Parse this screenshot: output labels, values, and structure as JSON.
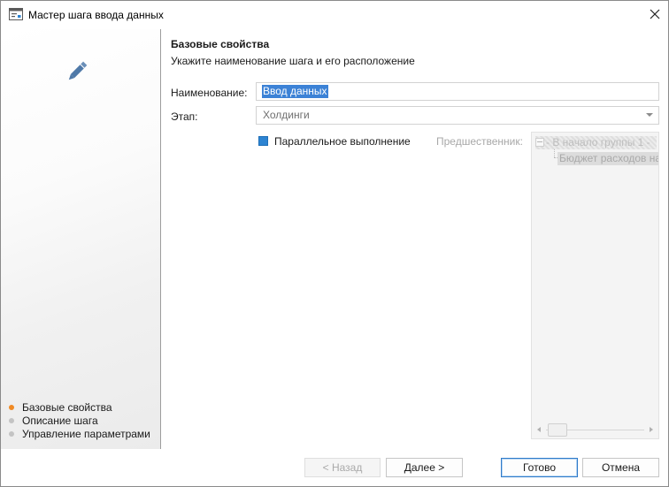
{
  "window": {
    "title": "Мастер шага ввода данных",
    "title_icon": "wizard-window-icon",
    "close_icon": "close-icon"
  },
  "sidebar": {
    "illustration_icon": "pencil-icon",
    "steps": [
      {
        "label": "Базовые свойства",
        "active": true
      },
      {
        "label": "Описание шага",
        "active": false
      },
      {
        "label": "Управление параметрами",
        "active": false
      }
    ],
    "active_color": "#f08a24",
    "inactive_color": "#c3c3c3"
  },
  "page": {
    "title": "Базовые свойства",
    "subtitle": "Укажите наименование шага и его расположение"
  },
  "form": {
    "name_label": "Наименование:",
    "name_value": "Ввод данных",
    "stage_label": "Этап:",
    "stage_value": "Холдинги",
    "parallel_label": "Параллельное выполнение",
    "parallel_checked": true,
    "predecessor_label": "Предшественник:",
    "predecessor_tree": [
      {
        "label": "- В начало группы 1 -"
      },
      {
        "label": "Бюджет расходов на"
      }
    ]
  },
  "buttons": {
    "back": "< Назад",
    "next": "Далее >",
    "finish": "Готово",
    "cancel": "Отмена"
  },
  "colors": {
    "accent": "#2d84d2",
    "selection": "#3c82d6"
  }
}
